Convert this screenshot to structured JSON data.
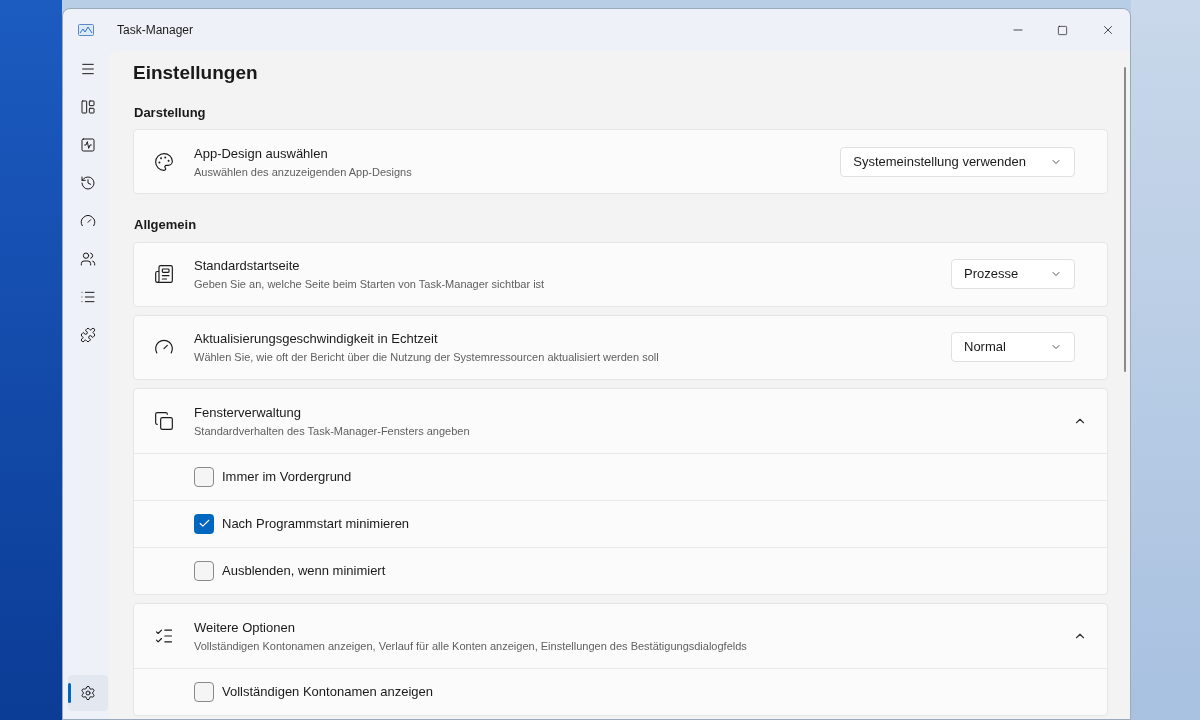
{
  "window": {
    "title": "Task-Manager"
  },
  "nav": [
    {
      "kind": "menu",
      "selected": false
    },
    {
      "kind": "processes",
      "selected": false
    },
    {
      "kind": "performance",
      "selected": false
    },
    {
      "kind": "history",
      "selected": false
    },
    {
      "kind": "startup",
      "selected": false
    },
    {
      "kind": "users",
      "selected": false
    },
    {
      "kind": "details",
      "selected": false
    },
    {
      "kind": "services",
      "selected": false
    },
    {
      "kind": "settings",
      "selected": true
    }
  ],
  "page_title": "Einstellungen",
  "sections": [
    {
      "heading": "Darstellung",
      "cards": [
        {
          "kind": "dropdown",
          "title": "App-Design auswählen",
          "description": "Auswählen des anzuzeigenden App-Designs",
          "value": "Systemeinstellung verwenden"
        }
      ]
    },
    {
      "heading": "Allgemein",
      "cards": [
        {
          "kind": "dropdown",
          "title": "Standardstartseite",
          "description": "Geben Sie an, welche Seite beim Starten von Task-Manager sichtbar ist",
          "value": "Prozesse"
        },
        {
          "kind": "dropdown",
          "title": "Aktualisierungsgeschwindigkeit in Echtzeit",
          "description": "Wählen Sie, wie oft der Bericht über die Nutzung der Systemressourcen aktualisiert werden soll",
          "value": "Normal"
        },
        {
          "kind": "expander",
          "title": "Fensterverwaltung",
          "description": "Standardverhalten des Task-Manager-Fensters angeben",
          "expanded": true,
          "options": [
            {
              "label": "Immer im Vordergrund",
              "checked": false
            },
            {
              "label": "Nach Programmstart minimieren",
              "checked": true
            },
            {
              "label": "Ausblenden, wenn minimiert",
              "checked": false
            }
          ]
        },
        {
          "kind": "expander",
          "title": "Weitere Optionen",
          "description": "Vollständigen Kontonamen anzeigen, Verlauf für alle Konten anzeigen, Einstellungen des Bestätigungsdialogfelds",
          "expanded": true,
          "options": [
            {
              "label": "Vollständigen Kontonamen anzeigen",
              "checked": false
            }
          ]
        }
      ]
    }
  ]
}
